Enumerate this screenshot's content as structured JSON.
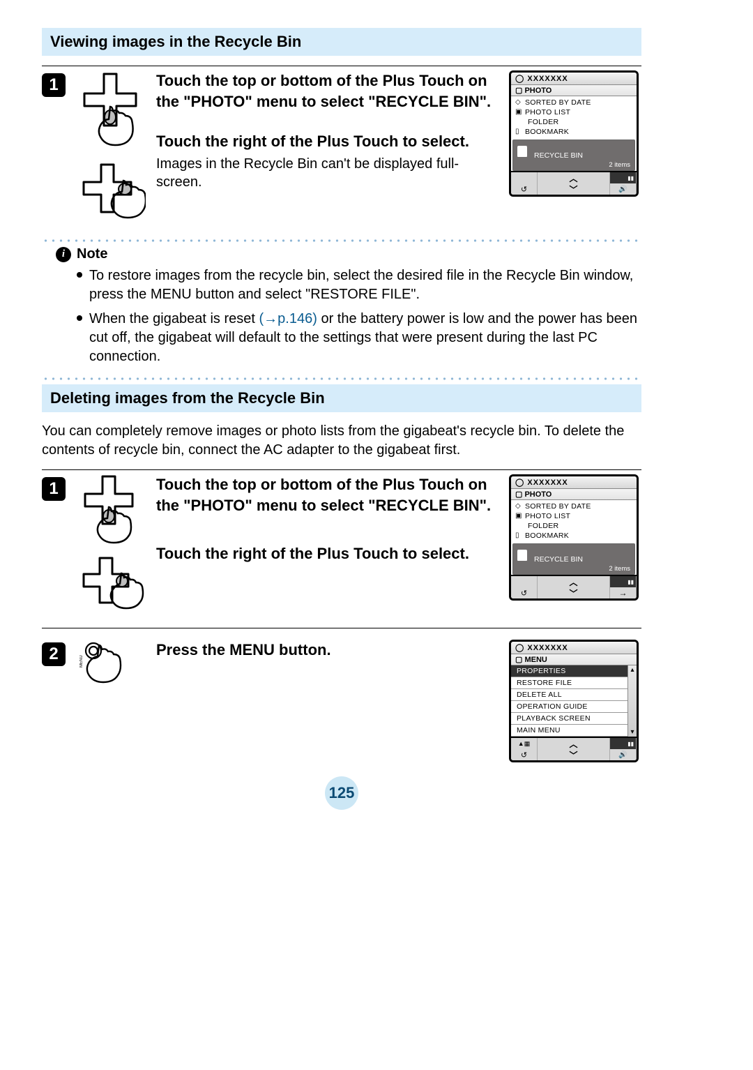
{
  "section1": {
    "heading": "Viewing images in the Recycle Bin",
    "step1": {
      "num": "1",
      "instr_a": "Touch the top or bottom of the Plus Touch on the \"PHOTO\" menu to select \"RECYCLE BIN\".",
      "instr_b": "Touch the right of the Plus Touch to select.",
      "body": "Images in the Recycle Bin can't be displayed full-screen."
    },
    "screen": {
      "title": "XXXXXXX",
      "crumb": "PHOTO",
      "items": [
        "SORTED BY DATE",
        "PHOTO LIST",
        "FOLDER",
        "BOOKMARK"
      ],
      "selected": "RECYCLE BIN",
      "count": "2 items"
    }
  },
  "note": {
    "label": "Note",
    "b1": "To restore images from the recycle bin, select the desired file in the Recycle Bin window, press the MENU button and select \"RESTORE FILE\".",
    "b2_a": "When the gigabeat is reset ",
    "b2_link": "p.146",
    "b2_b": " or the battery power is low and the power has been cut off, the gigabeat will default to the settings that were present during the last PC connection."
  },
  "section2": {
    "heading": "Deleting images from the Recycle Bin",
    "intro": "You can completely remove images or photo lists from the gigabeat's recycle bin. To delete the contents of recycle bin, connect the AC adapter to the gigabeat first.",
    "step1": {
      "num": "1",
      "instr_a": "Touch the top or bottom of the Plus Touch on the \"PHOTO\" menu to select \"RECYCLE BIN\".",
      "instr_b": "Touch the right of the Plus Touch to select."
    },
    "screen1": {
      "title": "XXXXXXX",
      "crumb": "PHOTO",
      "items": [
        "SORTED BY DATE",
        "PHOTO LIST",
        "FOLDER",
        "BOOKMARK"
      ],
      "selected": "RECYCLE BIN",
      "count": "2 items"
    },
    "step2": {
      "num": "2",
      "instr": "Press the MENU button.",
      "btn_label": "MENU"
    },
    "screen2": {
      "title": "XXXXXXX",
      "crumb": "MENU",
      "items": [
        "PROPERTIES",
        "RESTORE FILE",
        "DELETE ALL",
        "OPERATION GUIDE",
        "PLAYBACK SCREEN",
        "MAIN MENU"
      ]
    }
  },
  "page_number": "125"
}
